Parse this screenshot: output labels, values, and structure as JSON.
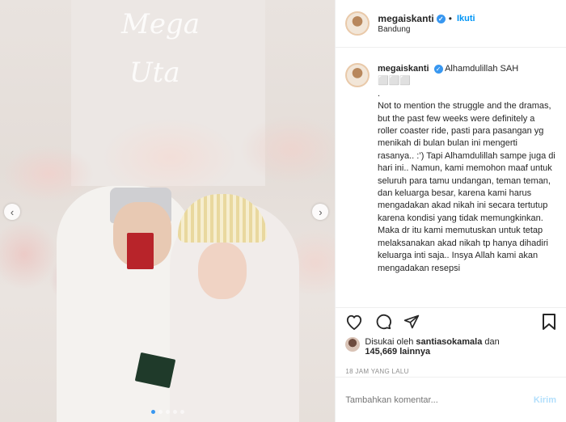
{
  "media": {
    "script_top": "Mega",
    "script_bottom": "Uta",
    "dots_count": 5,
    "active_dot": 1
  },
  "header": {
    "username": "megaiskanti",
    "follow_label": "Ikuti",
    "location": "Bandung"
  },
  "caption": {
    "username": "megaiskanti",
    "text": "Alhamdulillah SAH\n⬜⬜⬜\n.\nNot to mention the struggle and the dramas, but the past few weeks were definitely a roller coaster ride, pasti para pasangan yg menikah di bulan bulan ini mengerti rasanya.. :’) Tapi Alhamdulillah sampe juga di hari ini.. Namun, kami memohon maaf untuk seluruh para tamu undangan, teman teman, dan keluarga besar, karena kami harus mengadakan akad nikah ini secara tertutup karena kondisi yang tidak memungkinkan. Maka dr itu kami memutuskan untuk tetap melaksanakan akad nikah tp hanya dihadiri keluarga inti saja.. Insya Allah kami akan mengadakan resepsi"
  },
  "likes": {
    "prefix": "Disukai oleh",
    "user": "santiasokamala",
    "connector": "dan",
    "count": "145,669",
    "suffix": "lainnya"
  },
  "timestamp": "18 JAM YANG LALU",
  "comment": {
    "placeholder": "Tambahkan komentar...",
    "post_label": "Kirim"
  },
  "colors": {
    "accent": "#0095f6",
    "verified": "#3897f0",
    "muted": "#8e8e8e"
  }
}
